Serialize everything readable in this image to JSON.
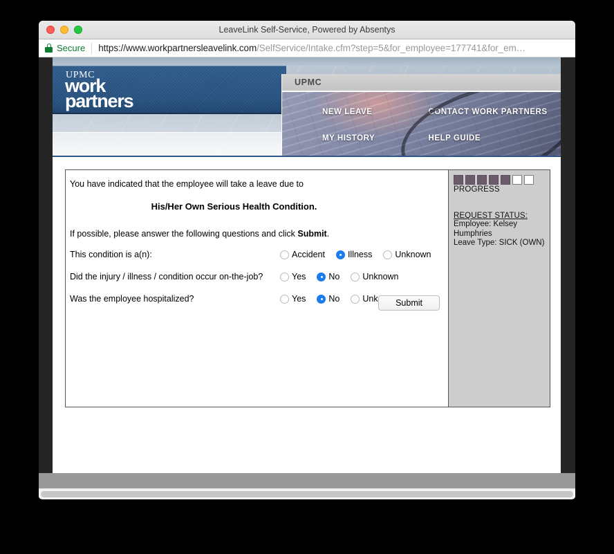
{
  "window": {
    "title": "LeaveLink Self-Service, Powered by Absentys",
    "traffic_lights": [
      "close-red",
      "minimize-yellow",
      "zoom-green"
    ]
  },
  "urlbar": {
    "security_icon": "lock-icon",
    "security_label": "Secure",
    "url_host": "https://www.workpartnersleavelink.com",
    "url_path": "/SelfService/Intake.cfm?step=5&for_employee=177741&for_em…"
  },
  "site_header": {
    "logo_top": "UPMC",
    "logo_line1": "work",
    "logo_line2": "partners"
  },
  "nav": {
    "panel_title": "UPMC",
    "links": [
      {
        "label": "NEW LEAVE"
      },
      {
        "label": "CONTACT WORK PARTNERS"
      },
      {
        "label": "MY HISTORY"
      },
      {
        "label": "HELP GUIDE"
      }
    ]
  },
  "form": {
    "intro": "You have indicated that the employee will take a leave due to",
    "condition": "His/Her Own Serious Health Condition.",
    "instruction_pre": "If possible, please answer the following questions and click ",
    "instruction_bold": "Submit",
    "instruction_post": ".",
    "questions": [
      {
        "label": "This condition is a(n):",
        "options": [
          {
            "label": "Accident",
            "checked": false
          },
          {
            "label": "Illness",
            "checked": true
          },
          {
            "label": "Unknown",
            "checked": false
          }
        ]
      },
      {
        "label": "Did the injury / illness / condition occur on-the-job?",
        "options": [
          {
            "label": "Yes",
            "checked": false
          },
          {
            "label": "No",
            "checked": true
          },
          {
            "label": "Unknown",
            "checked": false
          }
        ]
      },
      {
        "label": "Was the employee hospitalized?",
        "options": [
          {
            "label": "Yes",
            "checked": false
          },
          {
            "label": "No",
            "checked": true
          },
          {
            "label": "Unknown",
            "checked": false
          }
        ]
      }
    ],
    "submit_label": "Submit"
  },
  "status_panel": {
    "progress_total": 7,
    "progress_filled": 5,
    "progress_label": "PROGRESS",
    "status_title": "REQUEST STATUS:",
    "employee_line": "Employee: Kelsey Humphries",
    "leave_type_line": "Leave Type: SICK (OWN)"
  },
  "colors": {
    "accent_blue": "#2b5685",
    "radio_checked": "#1b7ded",
    "progress_filled": "#6b5b6b",
    "secure_green": "#0a7d33",
    "status_panel_bg": "#cdcdcd"
  }
}
